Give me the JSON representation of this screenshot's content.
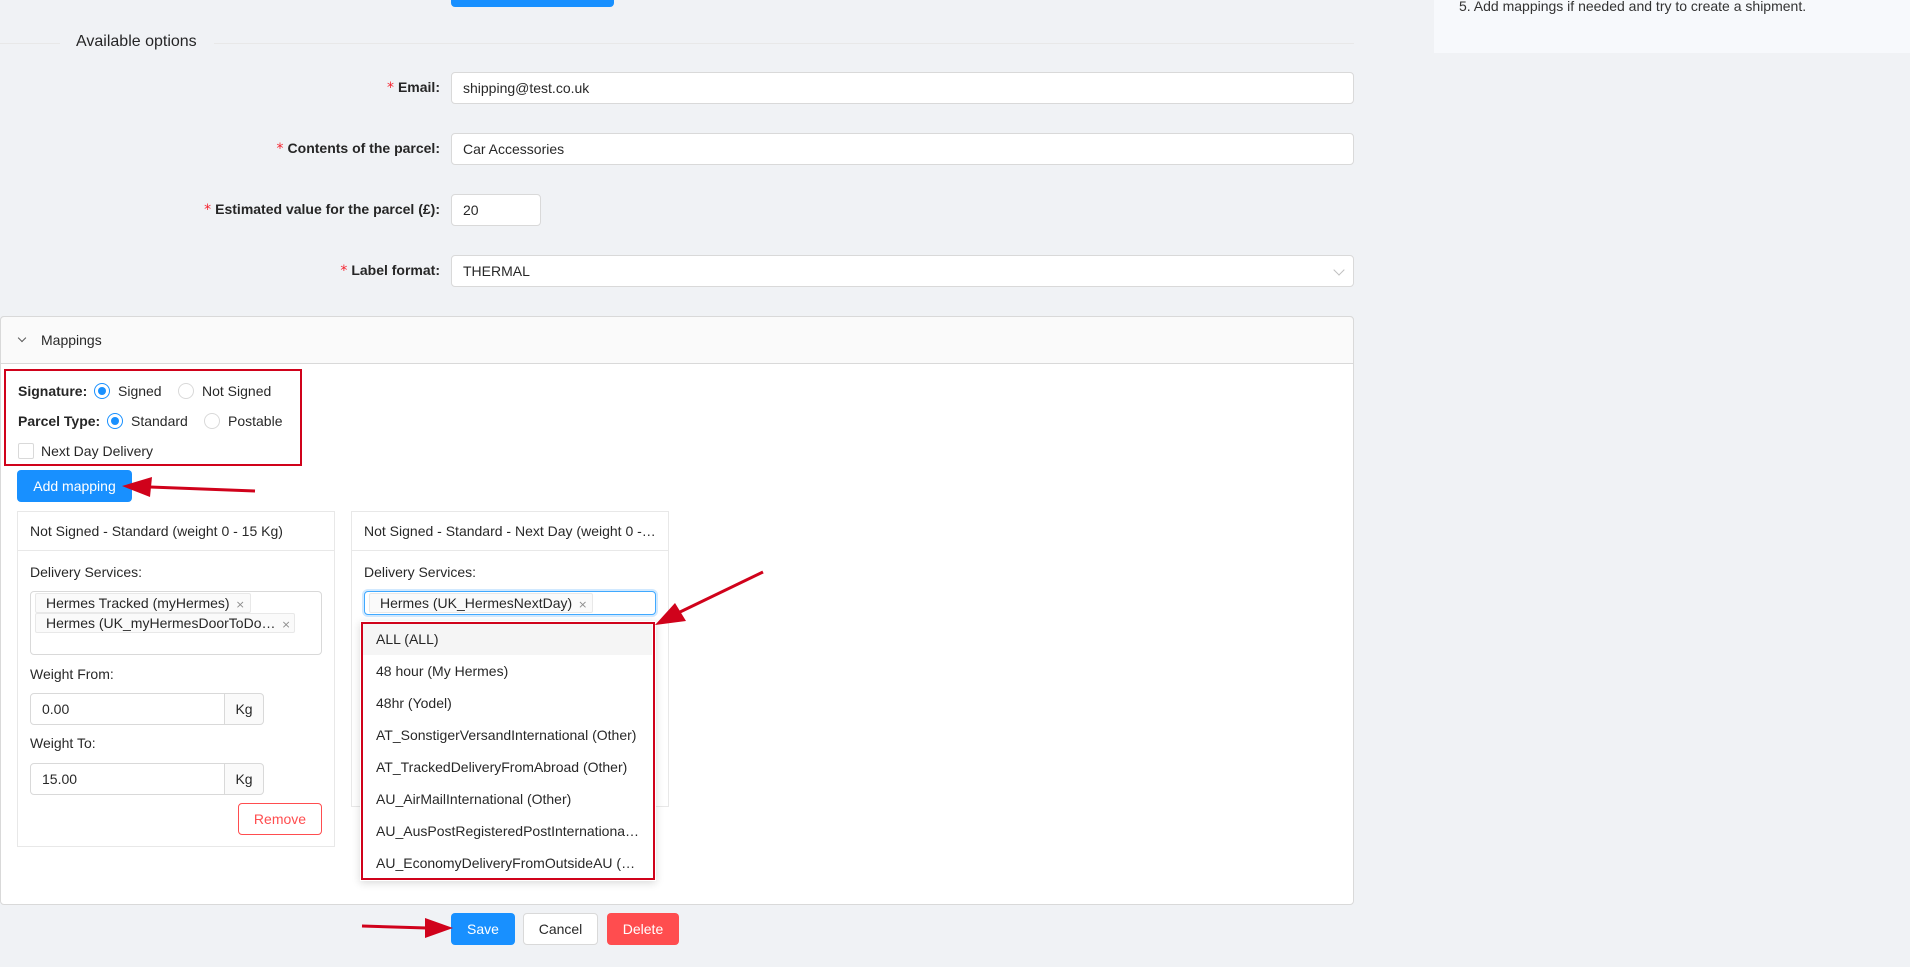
{
  "right_panel": {
    "step_text": "5. Add mappings if needed and try to create a shipment."
  },
  "section": {
    "available_options": "Available options"
  },
  "form": {
    "email": {
      "label": "Email",
      "value": "shipping@test.co.uk"
    },
    "contents": {
      "label": "Contents of the parcel",
      "value": "Car Accessories"
    },
    "value": {
      "label": "Estimated value for the parcel (£)",
      "value": "20"
    },
    "label_format": {
      "label": "Label format",
      "value": "THERMAL"
    },
    "required_mark": "*"
  },
  "mappings": {
    "title": "Mappings",
    "signature": {
      "label": "Signature:",
      "options": [
        "Signed",
        "Not Signed"
      ],
      "selected": "Signed"
    },
    "parcel_type": {
      "label": "Parcel Type:",
      "options": [
        "Standard",
        "Postable"
      ],
      "selected": "Standard"
    },
    "next_day": {
      "label": "Next Day Delivery",
      "checked": false
    },
    "add_button": "Add mapping",
    "cards": [
      {
        "title": "Not Signed - Standard (weight 0 - 15 Kg)",
        "delivery_label": "Delivery Services:",
        "tags": [
          "Hermes Tracked (myHermes)",
          "Hermes (UK_myHermesDoorToDo…"
        ],
        "weight_from_label": "Weight From:",
        "weight_from": "0.00",
        "weight_to_label": "Weight To:",
        "weight_to": "15.00",
        "unit": "Kg",
        "remove_label": "Remove"
      },
      {
        "title": "Not Signed - Standard - Next Day (weight 0 -…",
        "delivery_label": "Delivery Services:",
        "tags": [
          "Hermes (UK_HermesNextDay)"
        ]
      }
    ],
    "dropdown_options": [
      "ALL (ALL)",
      "48 hour (My Hermes)",
      "48hr (Yodel)",
      "AT_SonstigerVersandInternational (Other)",
      "AT_TrackedDeliveryFromAbroad (Other)",
      "AU_AirMailInternational (Other)",
      "AU_AusPostRegisteredPostInternational…",
      "AU_EconomyDeliveryFromOutsideAU (…"
    ]
  },
  "actions": {
    "save": "Save",
    "cancel": "Cancel",
    "delete": "Delete"
  },
  "colors": {
    "primary": "#1890ff",
    "danger": "#ff4d4f",
    "annotation": "#d0021b"
  },
  "tag_close_glyph": "×"
}
